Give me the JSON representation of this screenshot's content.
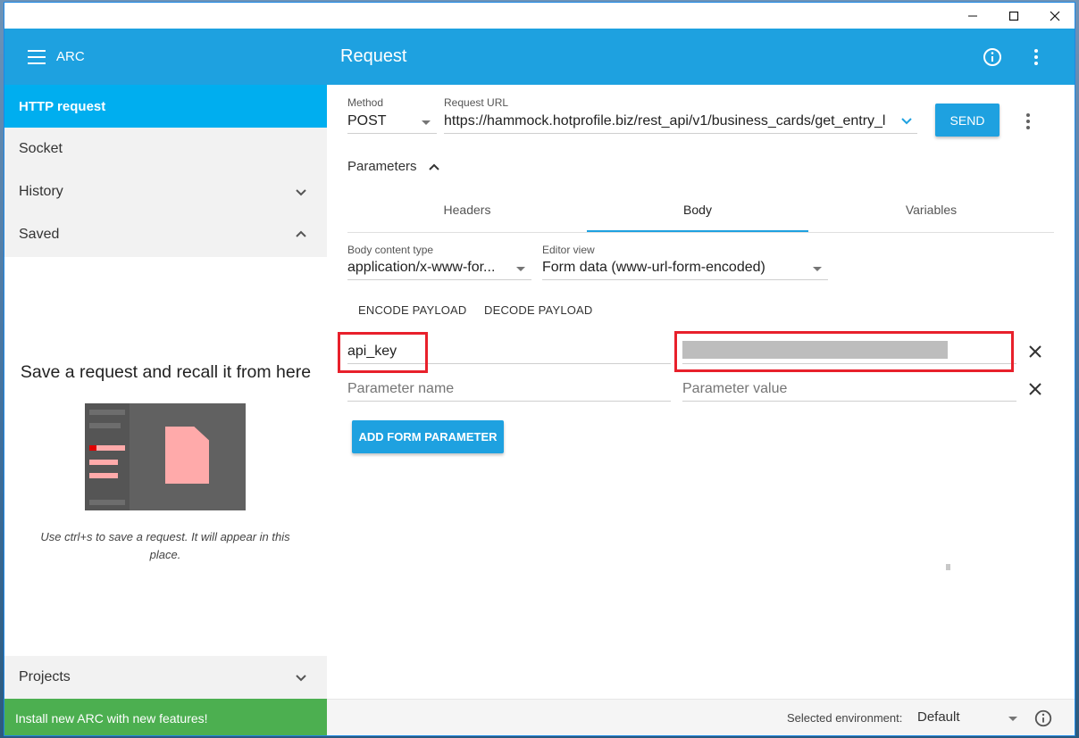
{
  "sidebar": {
    "app_title": "ARC",
    "items": [
      {
        "label": "HTTP request"
      },
      {
        "label": "Socket"
      },
      {
        "label": "History"
      },
      {
        "label": "Saved"
      }
    ],
    "saved_empty": {
      "title": "Save a request and recall it from here",
      "hint": "Use ctrl+s to save a request. It will appear in this place."
    },
    "projects_label": "Projects",
    "install_banner": "Install new ARC with new features!"
  },
  "header": {
    "title": "Request"
  },
  "request": {
    "method_label": "Method",
    "method": "POST",
    "url_label": "Request URL",
    "url": "https://hammock.hotprofile.biz/rest_api/v1/business_cards/get_entry_l",
    "send_label": "SEND"
  },
  "parameters": {
    "toggle_label": "Parameters",
    "tabs": [
      {
        "label": "Headers"
      },
      {
        "label": "Body"
      },
      {
        "label": "Variables"
      }
    ],
    "active_tab": "Body"
  },
  "body": {
    "content_type_label": "Body content type",
    "content_type": "application/x-www-for...",
    "editor_view_label": "Editor view",
    "editor_view": "Form data (www-url-form-encoded)",
    "encode_label": "ENCODE PAYLOAD",
    "decode_label": "DECODE PAYLOAD",
    "params": [
      {
        "name": "api_key",
        "value": ""
      }
    ],
    "name_placeholder": "Parameter name",
    "value_placeholder": "Parameter value",
    "add_label": "ADD FORM PARAMETER"
  },
  "footer": {
    "env_label": "Selected environment:",
    "env_value": "Default"
  },
  "colors": {
    "accent": "#1ea1e0",
    "active_nav": "#00aeef",
    "install_banner": "#4caf50",
    "highlight_box": "#e8202b"
  }
}
